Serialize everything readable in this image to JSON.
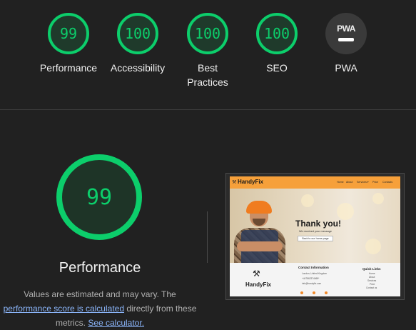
{
  "gauges": [
    {
      "score": "99",
      "label": "Performance"
    },
    {
      "score": "100",
      "label": "Accessibility"
    },
    {
      "score": "100",
      "label": "Best Practices"
    },
    {
      "score": "100",
      "label": "SEO"
    },
    {
      "score": "",
      "label": "PWA",
      "badge": "PWA"
    }
  ],
  "main": {
    "score": "99",
    "title": "Performance",
    "desc_prefix": "Values are estimated and may vary. The",
    "link_score": "performance score is calculated",
    "desc_mid": "directly from these metrics.",
    "link_calc": "See calculator."
  },
  "screenshot": {
    "brand": "HandyFix",
    "nav": [
      "Home",
      "About",
      "Services ▾",
      "Price",
      "Contacts"
    ],
    "hero_title": "Thank you!",
    "hero_sub": "We received your message",
    "hero_button": "Back to our home page",
    "footer_brand": "HandyFix",
    "contact_title": "Contact Information",
    "contact_lines": [
      "London, United Kingdom",
      "+447862374669*",
      "info@handyfix.com"
    ],
    "links_title": "Quick Links",
    "links": [
      "Home",
      "About",
      "Services",
      "Price",
      "Contact us"
    ]
  },
  "colors": {
    "pass": "#0cce6b",
    "background": "#212121",
    "link": "#8ab4f8"
  }
}
